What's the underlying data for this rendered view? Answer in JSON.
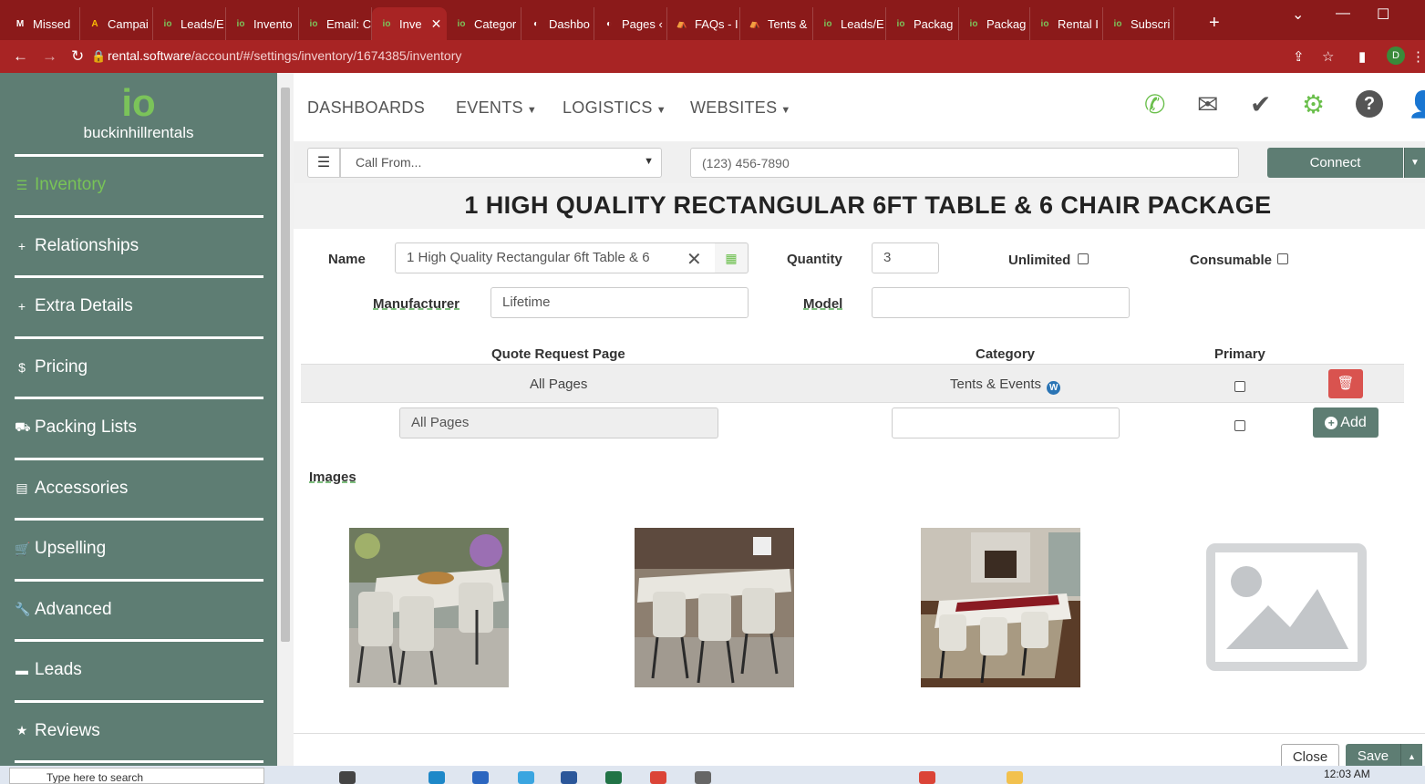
{
  "browser": {
    "tabs": [
      {
        "label": "Missed",
        "fav": "M",
        "color": "#fff"
      },
      {
        "label": "Campai",
        "fav": "A",
        "color": "#fbbc05"
      },
      {
        "label": "Leads/E",
        "fav": "io",
        "color": "#7bc35a"
      },
      {
        "label": "Invento",
        "fav": "io",
        "color": "#7bc35a"
      },
      {
        "label": "Email: C",
        "fav": "io",
        "color": "#7bc35a"
      },
      {
        "label": "Inve",
        "fav": "io",
        "color": "#7bc35a",
        "active": true
      },
      {
        "label": "Categor",
        "fav": "io",
        "color": "#7bc35a"
      },
      {
        "label": "Dashbo",
        "fav": "◐",
        "color": "#fff"
      },
      {
        "label": "Pages ‹",
        "fav": "◐",
        "color": "#fff"
      },
      {
        "label": "FAQs - I",
        "fav": "⛺",
        "color": "#fff"
      },
      {
        "label": "Tents &",
        "fav": "⛺",
        "color": "#fff"
      },
      {
        "label": "Leads/E",
        "fav": "io",
        "color": "#7bc35a"
      },
      {
        "label": "Packag",
        "fav": "io",
        "color": "#7bc35a"
      },
      {
        "label": "Packag",
        "fav": "io",
        "color": "#7bc35a"
      },
      {
        "label": "Rental I",
        "fav": "io",
        "color": "#7bc35a"
      },
      {
        "label": "Subscri",
        "fav": "io",
        "color": "#7bc35a"
      }
    ],
    "url_host": "rental.software",
    "url_path": "/account/#/settings/inventory/1674385/inventory",
    "profile_initial": "D"
  },
  "sidebar": {
    "logo_mark": "io",
    "logo_name": "buckinhillrentals",
    "items": [
      {
        "label": "Inventory",
        "icon": "☰",
        "icon_name": "list-icon",
        "active": true
      },
      {
        "label": "Relationships",
        "icon": "+",
        "icon_name": "plus-icon"
      },
      {
        "label": "Extra Details",
        "icon": "+",
        "icon_name": "plus-icon"
      },
      {
        "label": "Pricing",
        "icon": "$",
        "icon_name": "dollar-icon"
      },
      {
        "label": "Packing Lists",
        "icon": "⛟",
        "icon_name": "truck-icon"
      },
      {
        "label": "Accessories",
        "icon": "▤",
        "icon_name": "table-icon"
      },
      {
        "label": "Upselling",
        "icon": "🛒",
        "icon_name": "cart-icon"
      },
      {
        "label": "Advanced",
        "icon": "🔧",
        "icon_name": "wrench-icon"
      },
      {
        "label": "Leads",
        "icon": "▬",
        "icon_name": "inbox-icon"
      },
      {
        "label": "Reviews",
        "icon": "★",
        "icon_name": "star-icon"
      }
    ]
  },
  "topnav": {
    "dashboards": "DASHBOARDS",
    "events": "EVENTS",
    "logistics": "LOGISTICS",
    "websites": "WEBSITES"
  },
  "callbar": {
    "call_from": "Call From...",
    "phone_placeholder": "(123) 456-7890",
    "connect_label": "Connect"
  },
  "page": {
    "title": "1 HIGH QUALITY RECTANGULAR 6FT TABLE & 6 CHAIR PACKAGE"
  },
  "form": {
    "name_label": "Name",
    "name_value": "1 High Quality Rectangular 6ft Table & 6",
    "quantity_label": "Quantity",
    "quantity_value": "3",
    "unlimited_label": "Unlimited",
    "consumable_label": "Consumable",
    "manufacturer_label": "Manufacturer",
    "manufacturer_value": "Lifetime",
    "model_label": "Model",
    "model_value": ""
  },
  "pages_table": {
    "headers": {
      "quote_request_page": "Quote Request Page",
      "category": "Category",
      "primary": "Primary"
    },
    "row": {
      "page": "All Pages",
      "category": "Tents & Events"
    },
    "new_row": {
      "page": "All Pages",
      "category": ""
    },
    "add_label": "Add"
  },
  "images": {
    "label": "Images"
  },
  "footer": {
    "close_label": "Close",
    "save_label": "Save"
  },
  "taskbar": {
    "search_placeholder": "Type here to search",
    "time": "12:03 AM"
  },
  "colors": {
    "sidebar": "#5e7d73",
    "accent_green": "#7bc35a",
    "browser_red": "#a82424",
    "delete_red": "#d9534f"
  }
}
